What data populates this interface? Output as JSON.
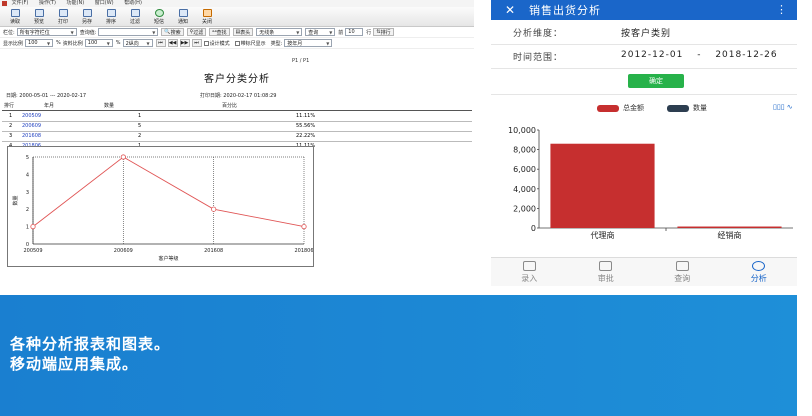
{
  "desktop": {
    "menu": [
      "文件(F)",
      "操作(T)",
      "功能(N)",
      "窗口(W)",
      "帮助(H)"
    ],
    "toolbar": [
      "读取",
      "预览",
      "打印",
      "另存",
      "排序",
      "过滤",
      "短信",
      "通知",
      "关闭"
    ],
    "filter": {
      "field_label": "栏位:",
      "field_value": "所有字符栏位",
      "query_label": "查询值:",
      "query_value": "",
      "search_btn": "搜索",
      "filter_btn": "过滤",
      "find_btn": "查找",
      "header_btn": "表头",
      "line_value": "无线条",
      "query_mode": "查询",
      "prev_label": "前",
      "prev_value": "10",
      "row_label": "行",
      "sort_btn": "排行"
    },
    "display": {
      "scale_label": "显示比例",
      "scale_value": "100",
      "pct1": "%",
      "data_scale_label": "资料比例",
      "data_scale_value": "100",
      "pct2": "%",
      "col_value": "2纵向",
      "design_mode": "设计模式",
      "show_ruler": "带标尺显示",
      "type_label": "类型:",
      "type_value": "按年月"
    },
    "report": {
      "page": "P1 / P1",
      "title": "客户分类分析",
      "date_label": "日期:",
      "date_from": "2000-05-01",
      "date_sep": "---",
      "date_to": "2020-02-17",
      "print_label": "打印日期:",
      "print_value": "2020-02-17 01:08:29",
      "headers": [
        "排行",
        "年月",
        "数量",
        "百分比"
      ],
      "rows": [
        {
          "rank": "1",
          "ym": "200509",
          "qty": "1",
          "pct": "11.11%"
        },
        {
          "rank": "2",
          "ym": "200609",
          "qty": "5",
          "pct": "55.56%"
        },
        {
          "rank": "3",
          "ym": "201608",
          "qty": "2",
          "pct": "22.22%"
        },
        {
          "rank": "4",
          "ym": "201806",
          "qty": "1",
          "pct": "11.11%"
        }
      ]
    }
  },
  "chart_data": [
    {
      "type": "line",
      "categories": [
        "200509",
        "200609",
        "201608",
        "201806"
      ],
      "series": [
        {
          "values": [
            1,
            5,
            2,
            1
          ]
        }
      ],
      "xlabel": "客户等级",
      "ylabel": "数量",
      "ylim": [
        0,
        5
      ],
      "yticks": [
        "0",
        "1",
        "2",
        "3",
        "4",
        "5"
      ],
      "color": "#e05555",
      "grid": true
    },
    {
      "type": "bar",
      "categories": [
        "代理商",
        "经销商"
      ],
      "series": [
        {
          "name": "总金额",
          "values": [
            8600,
            150
          ],
          "color": "#c62f2f"
        },
        {
          "name": "数量",
          "values": [
            0,
            0
          ],
          "color": "#2d3e50"
        }
      ],
      "ylim": [
        0,
        10000
      ],
      "yticks": [
        "0",
        "2,000",
        "4,000",
        "6,000",
        "8,000",
        "10,000"
      ],
      "legend": "top"
    }
  ],
  "mobile": {
    "title": "销售出货分析",
    "close": "✕",
    "more": "⋮",
    "dim_label": "分析维度：",
    "dim_value": "按客户类别",
    "range_label": "时间范围：",
    "range_from": "2012-12-01",
    "range_sep": "-",
    "range_to": "2018-12-26",
    "confirm": "确定",
    "chart_icons": "▯▯▯  ∿",
    "tabs": [
      "录入",
      "审批",
      "查询",
      "分析"
    ]
  },
  "banner": {
    "line1": "各种分析报表和图表。",
    "line2": "移动端应用集成。"
  }
}
